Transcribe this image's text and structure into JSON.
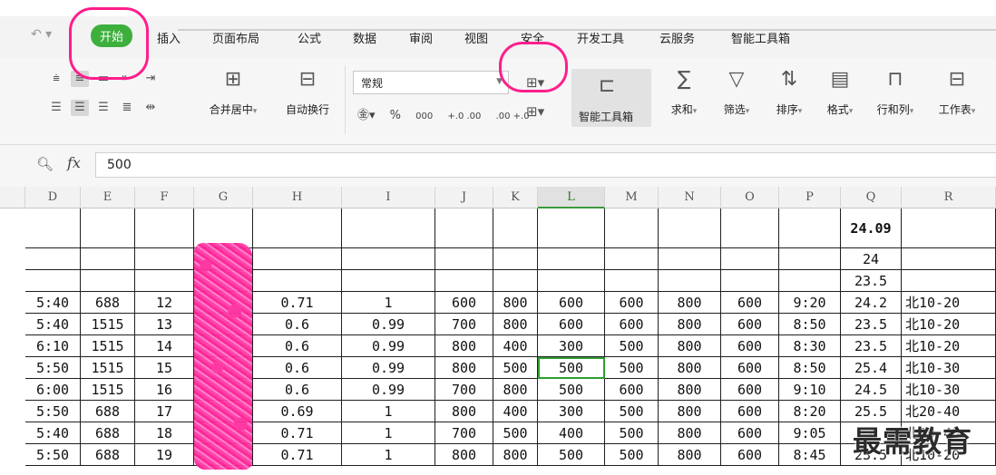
{
  "menubar": {
    "tabs": [
      "开始",
      "插入",
      "页面布局",
      "公式",
      "数据",
      "审阅",
      "视图",
      "安全",
      "开发工具",
      "云服务",
      "智能工具箱"
    ],
    "active_tab": "开始"
  },
  "ribbon": {
    "merge_label": "合并居中",
    "wrap_label": "自动换行",
    "number_format": "常规",
    "smart_toolbox_label": "智能工具箱",
    "sum_label": "求和",
    "filter_label": "筛选",
    "sort_label": "排序",
    "format_label": "格式",
    "rowcol_label": "行和列",
    "worksheet_label": "工作表",
    "percent_symbol": "%",
    "thousands_symbol": "000",
    "inc_decimal": "+.0 .00",
    "dec_decimal": ".00 +.0"
  },
  "formula_bar": {
    "fx_label": "fx",
    "value": "500"
  },
  "grid": {
    "columns": [
      "D",
      "E",
      "F",
      "G",
      "H",
      "I",
      "J",
      "K",
      "L",
      "M",
      "N",
      "O",
      "P",
      "Q",
      "R"
    ],
    "selected_column": "L",
    "rows": [
      [
        "",
        "",
        "",
        "",
        "",
        "",
        "",
        "",
        "",
        "",
        "",
        "",
        "",
        "24.09",
        ""
      ],
      [
        "",
        "",
        "",
        "",
        "",
        "",
        "",
        "",
        "",
        "",
        "",
        "",
        "",
        "24",
        ""
      ],
      [
        "",
        "",
        "",
        "",
        "",
        "",
        "",
        "",
        "",
        "",
        "",
        "",
        "",
        "23.5",
        ""
      ],
      [
        "5:40",
        "688",
        "12",
        "",
        "0.71",
        "1",
        "600",
        "800",
        "600",
        "600",
        "800",
        "600",
        "9:20",
        "24.2",
        "北10-20"
      ],
      [
        "5:40",
        "1515",
        "13",
        "",
        "0.6",
        "0.99",
        "700",
        "800",
        "600",
        "600",
        "800",
        "600",
        "8:50",
        "23.5",
        "北10-20"
      ],
      [
        "6:10",
        "1515",
        "14",
        "",
        "0.6",
        "0.99",
        "800",
        "400",
        "300",
        "500",
        "800",
        "600",
        "8:30",
        "23.5",
        "北10-20"
      ],
      [
        "5:50",
        "1515",
        "15",
        "",
        "0.6",
        "0.99",
        "800",
        "500",
        "500",
        "500",
        "800",
        "600",
        "8:50",
        "25.4",
        "北10-30"
      ],
      [
        "6:00",
        "1515",
        "16",
        "",
        "0.6",
        "0.99",
        "700",
        "800",
        "500",
        "600",
        "800",
        "600",
        "9:10",
        "24.5",
        "北10-30"
      ],
      [
        "5:50",
        "688",
        "17",
        "",
        "0.69",
        "1",
        "800",
        "400",
        "300",
        "500",
        "800",
        "600",
        "8:20",
        "25.5",
        "北20-40"
      ],
      [
        "5:40",
        "688",
        "18",
        "",
        "0.71",
        "1",
        "700",
        "500",
        "400",
        "500",
        "800",
        "600",
        "9:05",
        "2",
        "北10-40"
      ],
      [
        "5:50",
        "688",
        "19",
        "",
        "0.71",
        "1",
        "800",
        "800",
        "500",
        "500",
        "800",
        "600",
        "8:45",
        "23.5",
        "北10-20"
      ]
    ]
  },
  "watermark": "最需教育",
  "colors": {
    "active_tab_bg": "#3daf3d",
    "annotation": "#ff1e8c",
    "active_cell": "#2f9e2f"
  }
}
